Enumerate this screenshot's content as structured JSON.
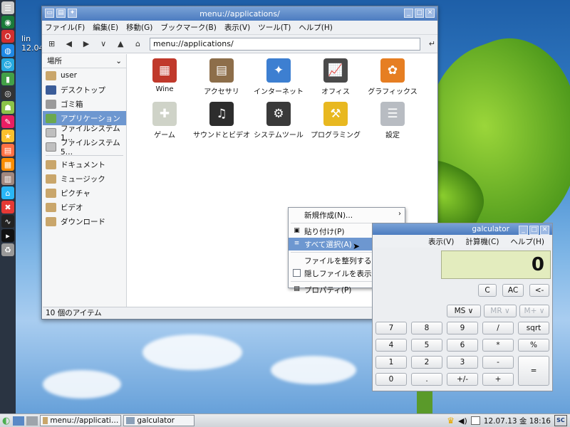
{
  "desktop": {
    "label_line1": "lin",
    "label_line2": "12.04"
  },
  "file_manager": {
    "title": "menu://applications/",
    "menus": [
      "ファイル(F)",
      "編集(E)",
      "移動(G)",
      "ブックマーク(B)",
      "表示(V)",
      "ツール(T)",
      "ヘルプ(H)"
    ],
    "path": "menu://applications/",
    "sidebar_header": "場所",
    "places": [
      {
        "label": "user",
        "icon": "home-icon",
        "color": "#c9a66b"
      },
      {
        "label": "デスクトップ",
        "icon": "desktop-icon",
        "color": "#3b5d99"
      },
      {
        "label": "ゴミ箱",
        "icon": "trash-icon",
        "color": "#9a9a9a"
      },
      {
        "label": "アプリケーション",
        "icon": "applications-icon",
        "color": "#6aa84f",
        "selected": true
      },
      {
        "label": "ファイルシステム 1…",
        "icon": "drive-icon",
        "color": "#bfbfbf"
      },
      {
        "label": "ファイルシステム 5…",
        "icon": "drive-icon",
        "color": "#bfbfbf"
      }
    ],
    "bookmarks": [
      {
        "label": "ドキュメント",
        "icon": "folder-icon"
      },
      {
        "label": "ミュージック",
        "icon": "folder-icon"
      },
      {
        "label": "ピクチャ",
        "icon": "folder-icon"
      },
      {
        "label": "ビデオ",
        "icon": "folder-icon"
      },
      {
        "label": "ダウンロード",
        "icon": "folder-icon"
      }
    ],
    "apps": [
      {
        "label": "Wine",
        "icon": "wine-icon",
        "color": "#c0392b",
        "glyph": "▦"
      },
      {
        "label": "アクセサリ",
        "icon": "accessories-icon",
        "color": "#8d6e4a",
        "glyph": "▤"
      },
      {
        "label": "インターネット",
        "icon": "internet-icon",
        "color": "#3d7fd1",
        "glyph": "✦"
      },
      {
        "label": "オフィス",
        "icon": "office-icon",
        "color": "#4a4a4a",
        "glyph": "📈"
      },
      {
        "label": "グラフィックス",
        "icon": "graphics-icon",
        "color": "#e67e22",
        "glyph": "✿"
      },
      {
        "label": "ゲーム",
        "icon": "games-icon",
        "color": "#cfd3c8",
        "glyph": "✚"
      },
      {
        "label": "サウンドとビデオ",
        "icon": "sound-video-icon",
        "color": "#2d2d2d",
        "glyph": "♫"
      },
      {
        "label": "システムツール",
        "icon": "system-tools-icon",
        "color": "#3a3a3a",
        "glyph": "⚙"
      },
      {
        "label": "プログラミング",
        "icon": "programming-icon",
        "color": "#e8b820",
        "glyph": "⚒"
      },
      {
        "label": "設定",
        "icon": "settings-icon",
        "color": "#b8bcc2",
        "glyph": "☰"
      }
    ],
    "status": "10 個のアイテム"
  },
  "context_menu": {
    "new": "新規作成(N)...",
    "paste": "貼り付け(P)",
    "select_all": "すべて選択(A)",
    "arrange": "ファイルを整列する(S)",
    "show_hidden": "隠しファイルを表示する",
    "properties": "プロパティ(P)"
  },
  "calculator": {
    "title": "galculator",
    "menus": [
      "表示(V)",
      "計算機(C)",
      "ヘルプ(H)"
    ],
    "display": "0",
    "buttons": {
      "c": "C",
      "ac": "AC",
      "back": "<-",
      "ms": "MS ∨",
      "mr": "MR ∨",
      "mplus": "M+ ∨",
      "n7": "7",
      "n8": "8",
      "n9": "9",
      "div": "/",
      "sqrt": "sqrt",
      "n4": "4",
      "n5": "5",
      "n6": "6",
      "mul": "*",
      "pct": "%",
      "n1": "1",
      "n2": "2",
      "n3": "3",
      "sub": "-",
      "eq": "=",
      "n0": "0",
      "dot": ".",
      "neg": "+/-",
      "add": "+"
    }
  },
  "taskbar": {
    "tasks": [
      "menu://applicati…",
      "galculator"
    ],
    "clock": "12.07.13 金 18:16",
    "logo_text": "SC"
  }
}
